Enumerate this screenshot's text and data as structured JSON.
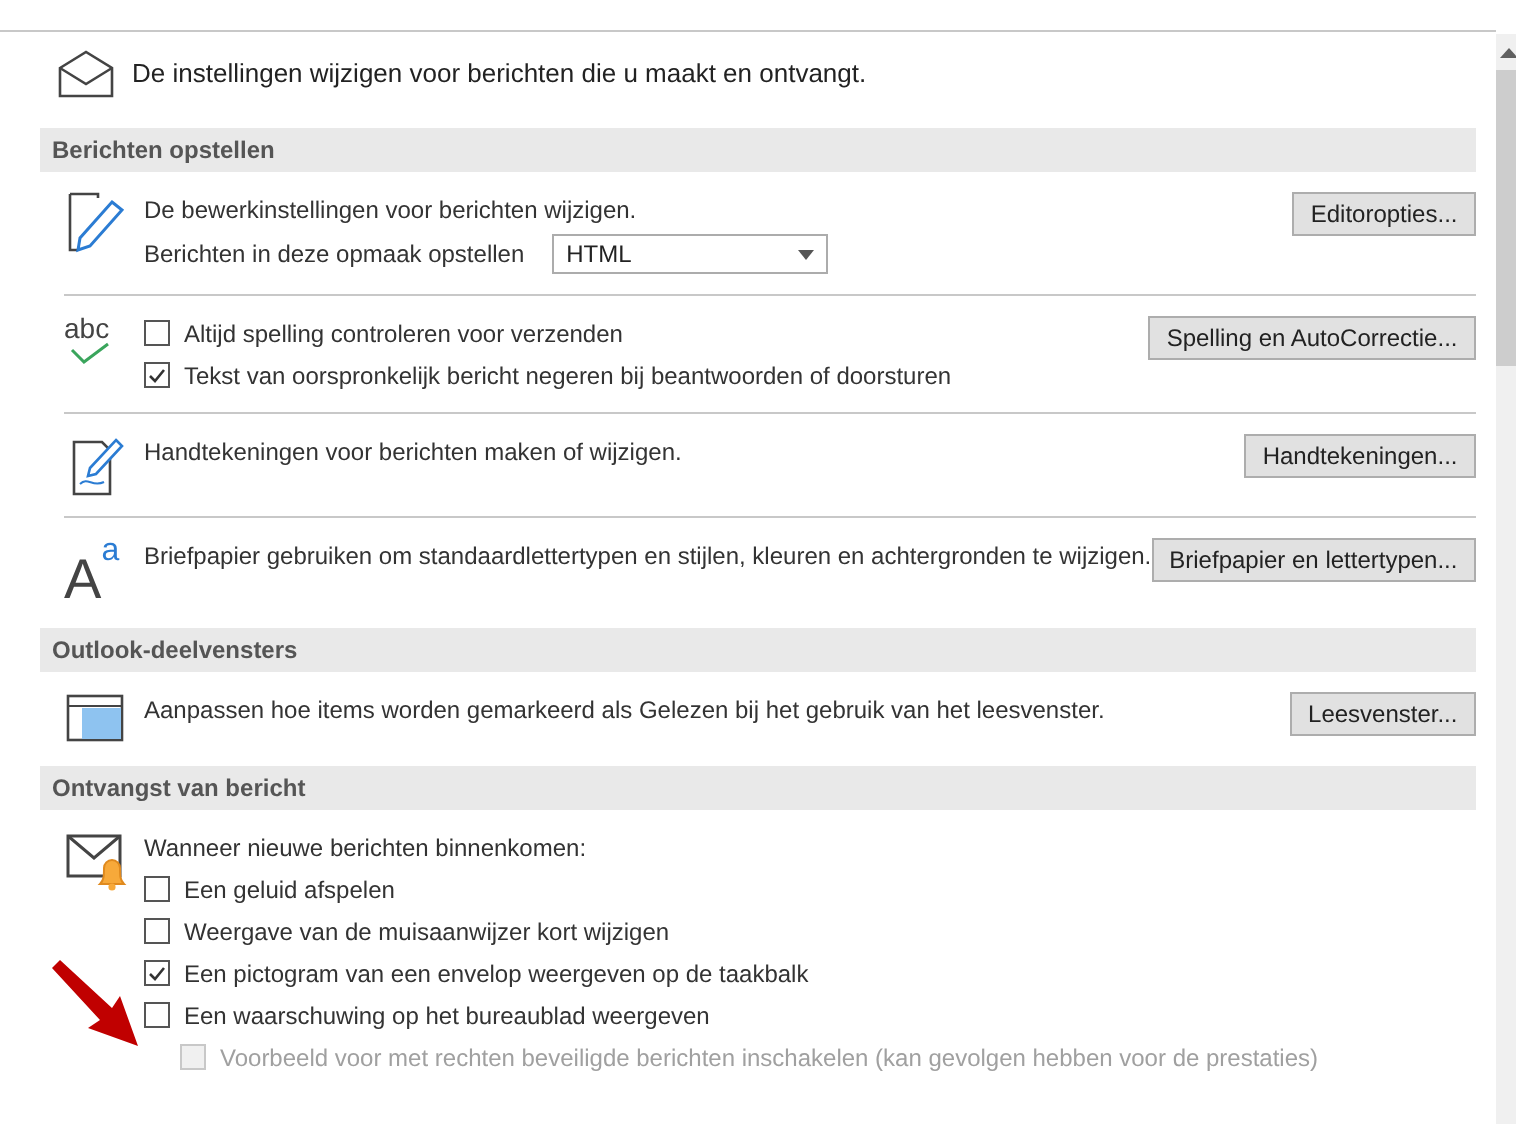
{
  "intro": "De instellingen wijzigen voor berichten die u maakt en ontvangt.",
  "sections": [
    {
      "heading": "Berichten opstellen",
      "groups": [
        {
          "kind": "edit",
          "lines": [
            {
              "kind": "text",
              "text": "De bewerkinstellingen voor berichten wijzigen."
            },
            {
              "kind": "select",
              "label": "Berichten in deze opmaak opstellen",
              "value": "HTML"
            }
          ],
          "button": "Editoropties..."
        },
        {
          "kind": "spelling",
          "icon_text": "abc",
          "lines": [
            {
              "kind": "checkbox",
              "text": "Altijd spelling controleren voor verzenden",
              "checked": false,
              "disabled": false
            },
            {
              "kind": "checkbox",
              "text": "Tekst van oorspronkelijk bericht negeren bij beantwoorden of doorsturen",
              "checked": true,
              "disabled": false
            }
          ],
          "button": "Spelling en AutoCorrectie..."
        },
        {
          "kind": "signature",
          "lines": [
            {
              "kind": "text",
              "text": "Handtekeningen voor berichten maken of wijzigen."
            }
          ],
          "button": "Handtekeningen..."
        },
        {
          "kind": "font",
          "icon_text": "A",
          "icon_subtext": "a",
          "lines": [
            {
              "kind": "text",
              "text": "Briefpapier gebruiken om standaardlettertypen en stijlen, kleuren en achtergronden te wijzigen."
            }
          ],
          "button": "Briefpapier en lettertypen..."
        }
      ]
    },
    {
      "heading": "Outlook-deelvensters",
      "groups": [
        {
          "kind": "pane",
          "lines": [
            {
              "kind": "text",
              "text": "Aanpassen hoe items worden gemarkeerd als Gelezen bij het gebruik van het leesvenster."
            }
          ],
          "button": "Leesvenster..."
        }
      ]
    },
    {
      "heading": "Ontvangst van bericht",
      "groups": [
        {
          "kind": "mail-bell",
          "lines": [
            {
              "kind": "text",
              "text": "Wanneer nieuwe berichten binnenkomen:"
            },
            {
              "kind": "checkbox",
              "text": "Een geluid afspelen",
              "checked": false,
              "disabled": false
            },
            {
              "kind": "checkbox",
              "text": "Weergave van de muisaanwijzer kort wijzigen",
              "checked": false,
              "disabled": false
            },
            {
              "kind": "checkbox",
              "text": "Een pictogram van een envelop weergeven op de taakbalk",
              "checked": true,
              "disabled": false
            },
            {
              "kind": "checkbox",
              "text": "Een waarschuwing op het bureaublad weergeven",
              "checked": false,
              "disabled": false
            },
            {
              "kind": "checkbox",
              "text": "Voorbeeld voor met rechten beveiligde berichten inschakelen (kan gevolgen hebben voor de prestaties)",
              "checked": false,
              "disabled": true,
              "indent": true
            }
          ]
        }
      ]
    }
  ]
}
